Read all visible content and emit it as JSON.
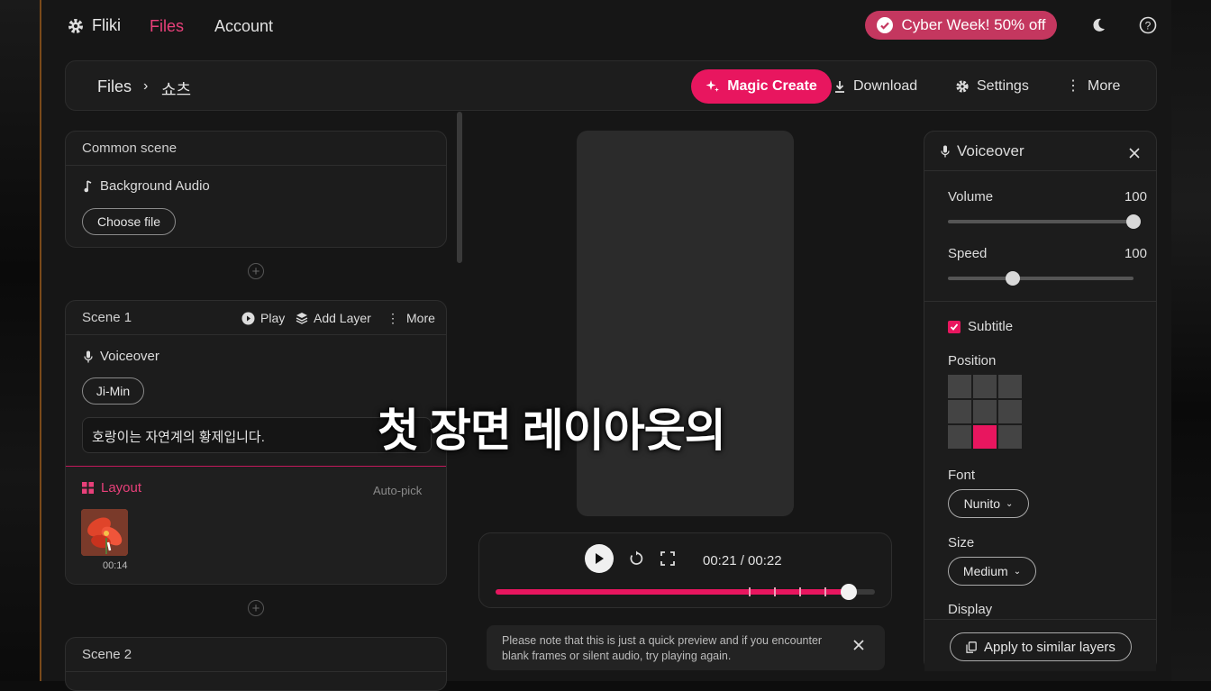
{
  "nav": {
    "app_name": "Fliki",
    "links": [
      {
        "label": "Files",
        "active": true
      },
      {
        "label": "Account",
        "active": false
      }
    ],
    "promo": "Cyber Week! 50% off"
  },
  "toolbar": {
    "breadcrumb": [
      "Files",
      "쇼츠"
    ],
    "magic_create": "Magic Create",
    "download": "Download",
    "settings": "Settings",
    "more": "More"
  },
  "common_scene": {
    "title": "Common scene",
    "background_audio": "Background Audio",
    "choose_file": "Choose file"
  },
  "scene1": {
    "title": "Scene 1",
    "play": "Play",
    "add_layer": "Add Layer",
    "more": "More",
    "voiceover_label": "Voiceover",
    "voice_name": "Ji-Min",
    "script_text": "호랑이는 자연계의 황제입니다.",
    "layout_label": "Layout",
    "auto_pick": "Auto-pick",
    "thumb_time": "00:14"
  },
  "scene2": {
    "title": "Scene 2"
  },
  "player": {
    "time": "00:21 / 00:22",
    "progress": 0.93
  },
  "preview_note": "Please note that this is just a quick preview and if you encounter blank frames or silent audio, try playing again.",
  "overlay_subtitle": "첫 장면 레이아웃의",
  "voiceover_panel": {
    "title": "Voiceover",
    "volume_label": "Volume",
    "volume_value": "100",
    "volume_level": 1.0,
    "speed_label": "Speed",
    "speed_value": "100",
    "speed_level": 0.35,
    "subtitle_label": "Subtitle",
    "subtitle_checked": true,
    "position_label": "Position",
    "position_selected": "bottom-center",
    "font_label": "Font",
    "font_value": "Nunito",
    "size_label": "Size",
    "size_value": "Medium",
    "display_label": "Display",
    "apply_button": "Apply to similar layers"
  },
  "colors": {
    "accent": "#e8165f",
    "active_link": "#e8407a",
    "promo_bg": "#c4375f"
  }
}
